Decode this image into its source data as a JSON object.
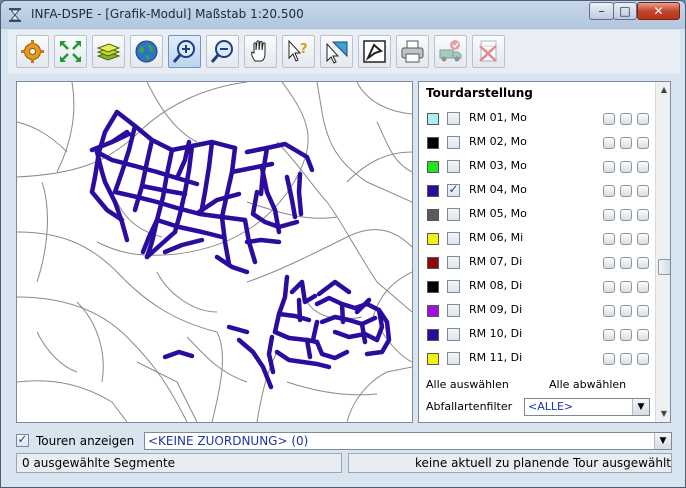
{
  "window": {
    "title": "INFA-DSPE - [Grafik-Modul] Maßstab 1:20.500",
    "app_icon": "hourglass-icon",
    "controls": {
      "minimize": "–",
      "maximize": "□",
      "close": "✕"
    }
  },
  "toolbar": {
    "buttons": [
      {
        "name": "settings-gear-icon",
        "active": false
      },
      {
        "name": "fit-extent-arrows-icon",
        "active": false
      },
      {
        "name": "layers-icon",
        "active": false
      },
      {
        "name": "globe-icon",
        "active": false
      },
      {
        "name": "zoom-in-icon",
        "active": true
      },
      {
        "name": "zoom-out-icon",
        "active": false
      },
      {
        "name": "pan-hand-icon",
        "active": false
      },
      {
        "name": "info-query-icon",
        "active": false
      },
      {
        "name": "select-pointer-icon",
        "active": false
      },
      {
        "name": "select-area-icon",
        "active": false
      },
      {
        "name": "print-icon",
        "active": false
      },
      {
        "name": "truck-route-icon",
        "active": false
      },
      {
        "name": "delete-document-icon",
        "active": false
      }
    ]
  },
  "panel": {
    "title": "Tourdarstellung",
    "tours": [
      {
        "label": "RM 01, Mo",
        "color": "#a8f2f5",
        "checked": false
      },
      {
        "label": "RM 02, Mo",
        "color": "#000000",
        "checked": false
      },
      {
        "label": "RM 03, Mo",
        "color": "#22e522",
        "checked": false
      },
      {
        "label": "RM 04, Mo",
        "color": "#2c0c9e",
        "checked": true
      },
      {
        "label": "RM 05, Mo",
        "color": "#5c5c5c",
        "checked": false
      },
      {
        "label": "RM 06, Mi",
        "color": "#f2f20e",
        "checked": false
      },
      {
        "label": "RM 07, Di",
        "color": "#8e0a0a",
        "checked": false
      },
      {
        "label": "RM 08, Di",
        "color": "#000000",
        "checked": false
      },
      {
        "label": "RM 09, Di",
        "color": "#a00ee6",
        "checked": false
      },
      {
        "label": "RM 10, Di",
        "color": "#2c0c9e",
        "checked": false
      },
      {
        "label": "RM 11, Di",
        "color": "#f2f20e",
        "checked": false
      }
    ],
    "check_mark": "✓",
    "select_all": "Alle auswählen",
    "deselect_all": "Alle abwählen",
    "filter_label": "Abfallartenfilter",
    "filter_value": "<ALLE>"
  },
  "bottom": {
    "show_tours_label": "Touren anzeigen",
    "show_tours_checked": true,
    "assignment_value": "<KEINE ZUORDNUNG> (0)",
    "status_left": "0 ausgewählte Segmente",
    "status_right": "keine aktuell zu planende Tour ausgewählt"
  },
  "colors": {
    "route": "#2c0c9e",
    "street": "#8a8a8a"
  }
}
